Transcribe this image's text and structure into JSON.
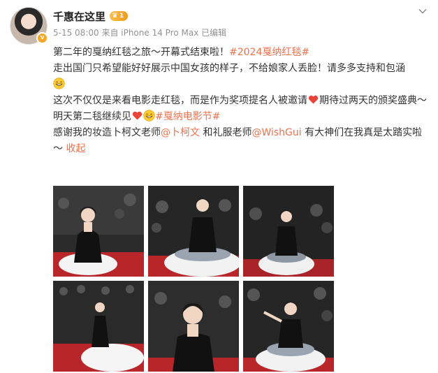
{
  "post": {
    "author": {
      "name": "千惠在这里",
      "vip_level": "1",
      "verified_badge": "v"
    },
    "meta": "5-15 08:00 来自 iPhone 14 Pro Max 已编辑",
    "text": {
      "line1_plain": "第二年的戛纳红毯之旅～开幕式结束啦！",
      "line1_topic": "#2024戛纳红毯#",
      "line2_plain": "走出国门只希望能好好展示中国女孩的样子，不给娘家人丢脸！请多多支持和包涵",
      "line3_plain_a": "这次不仅仅是来看电影走红毯，而是作为奖项提名人被邀请",
      "line3_plain_b": "期待过两天的颁奖盛典～",
      "line4_plain": "明天第二毯继续见",
      "line4_topic": "#戛纳电影节#",
      "line5_plain_a": "感谢我的妆造卜柯文老师",
      "line5_mention_a": "@卜柯文",
      "line5_plain_b": " 和礼服老师",
      "line5_mention_b": "@WishGui",
      "line5_plain_c": " 有大神们在我真是太踏实啦～ ",
      "collapse_label": "收起"
    },
    "emojis": [
      "grin-emoji",
      "heart-emoji",
      "heart-emoji",
      "grin-emoji"
    ],
    "photos": [
      {
        "name": "photo-1"
      },
      {
        "name": "photo-2"
      },
      {
        "name": "photo-3"
      },
      {
        "name": "photo-4"
      },
      {
        "name": "photo-5"
      },
      {
        "name": "photo-6"
      }
    ]
  },
  "colors": {
    "link": "#eb7350",
    "meta": "#939393",
    "heart": "#e8443a",
    "emoji": "#ffcc33"
  }
}
